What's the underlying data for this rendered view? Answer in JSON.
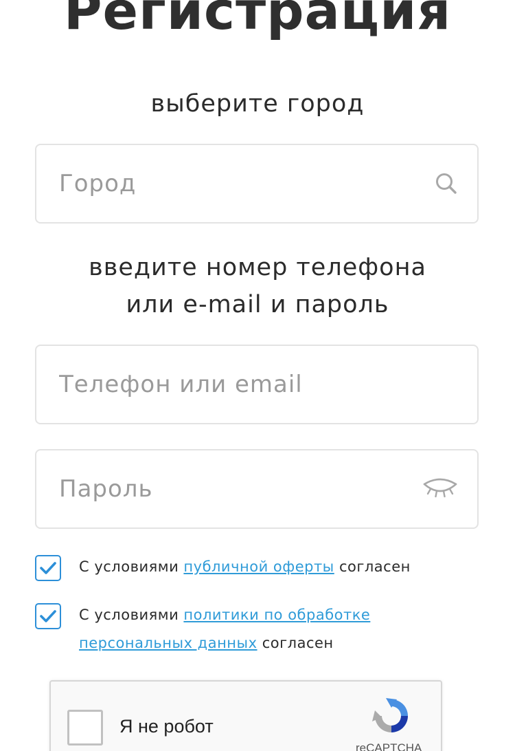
{
  "title": "Регистрация",
  "city_section": {
    "label": "выберите город",
    "placeholder": "Город",
    "icon": "search-icon"
  },
  "credentials_section": {
    "label_line1": "введите номер телефона",
    "label_line2": "или e-mail и пароль",
    "login_placeholder": "Телефон или email",
    "password_placeholder": "Пароль",
    "password_icon": "eye-closed-icon"
  },
  "agreements": [
    {
      "checked": true,
      "prefix": "С условиями ",
      "link": "публичной оферты",
      "suffix": " согласен"
    },
    {
      "checked": true,
      "prefix": "С условиями ",
      "link": "политики по обработке персональных данных",
      "suffix": " согласен"
    }
  ],
  "captcha": {
    "label": "Я не робот",
    "brand": "reCAPTCHA",
    "checked": false
  },
  "colors": {
    "accent": "#2c8fd8",
    "link": "#2f9bd8",
    "border": "#e3e3e3",
    "placeholder": "#9a9a9a"
  }
}
